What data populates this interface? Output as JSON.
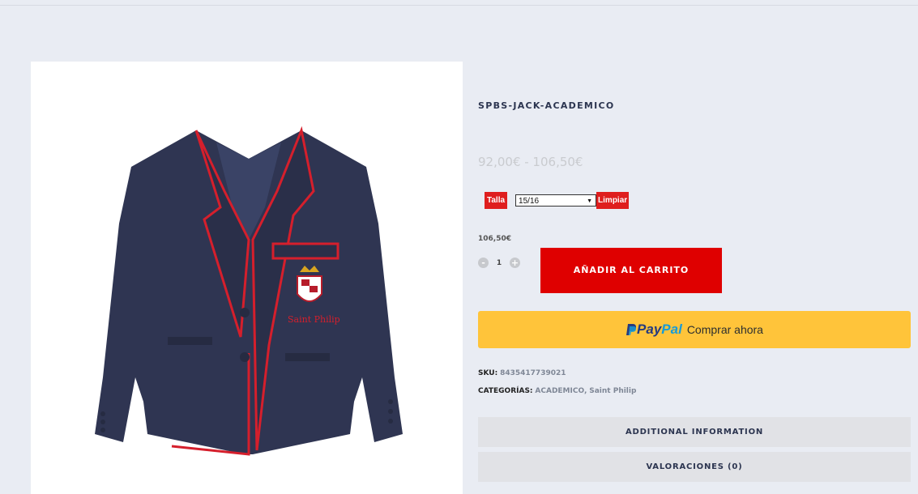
{
  "product": {
    "title": "SPBS-JACK-ACADEMICO",
    "price_range": "92,00€ - 106,50€",
    "variation": {
      "label": "Talla",
      "selected": "15/16",
      "clear_label": "Limpiar"
    },
    "selected_price": "106,50€",
    "quantity": "1",
    "qty_minus": "-",
    "qty_plus": "+",
    "add_to_cart_label": "AÑADIR AL CARRITO",
    "paypal": {
      "logo_p": "Pay",
      "logo_pal": "Pal",
      "text": "Comprar ahora"
    },
    "sku_label": "SKU:",
    "sku_value": "8435417739021",
    "categories_label": "CATEGORÍAS:",
    "categories": [
      "ACADEMICO",
      "Saint Philip"
    ],
    "category_separator": ",",
    "tabs": [
      "ADDITIONAL INFORMATION",
      "VALORACIONES (0)"
    ],
    "image_text": "Saint Philip"
  },
  "colors": {
    "accent_red": "#df0000",
    "paypal_yellow": "#ffc43a",
    "page_bg": "#e9ecf3",
    "title_navy": "#2c3550"
  }
}
